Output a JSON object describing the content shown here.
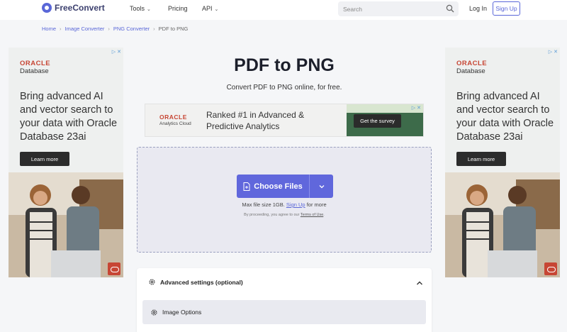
{
  "header": {
    "logo_text": "FreeConvert",
    "nav": [
      {
        "label": "Tools",
        "has_dropdown": true
      },
      {
        "label": "Pricing",
        "has_dropdown": false
      },
      {
        "label": "API",
        "has_dropdown": true
      }
    ],
    "search_placeholder": "Search",
    "login_label": "Log In",
    "signup_label": "Sign Up"
  },
  "breadcrumb": {
    "items": [
      "Home",
      "Image Converter",
      "PNG Converter"
    ],
    "current": "PDF to PNG"
  },
  "side_ad": {
    "brand": "ORACLE",
    "product": "Database",
    "headline": "Bring advanced AI and vector search to your data with Oracle Database 23ai",
    "cta": "Learn more"
  },
  "main": {
    "title": "PDF to PNG",
    "subtitle": "Convert PDF to PNG online, for free."
  },
  "banner_ad": {
    "brand": "ORACLE",
    "product": "Analytics Cloud",
    "text": "Ranked #1 in Advanced & Predictive Analytics",
    "cta": "Get the survey"
  },
  "upload": {
    "button_label": "Choose Files",
    "max_prefix": "Max file size 1GB.",
    "max_link": "Sign Up",
    "max_suffix": "for more",
    "terms_prefix": "By proceeding, you agree to our",
    "terms_link": "Terms of Use",
    "terms_suffix": "."
  },
  "settings": {
    "title": "Advanced settings (optional)",
    "section": "Image Options"
  },
  "colors": {
    "accent": "#6067dc",
    "oracle_red": "#c74634"
  }
}
